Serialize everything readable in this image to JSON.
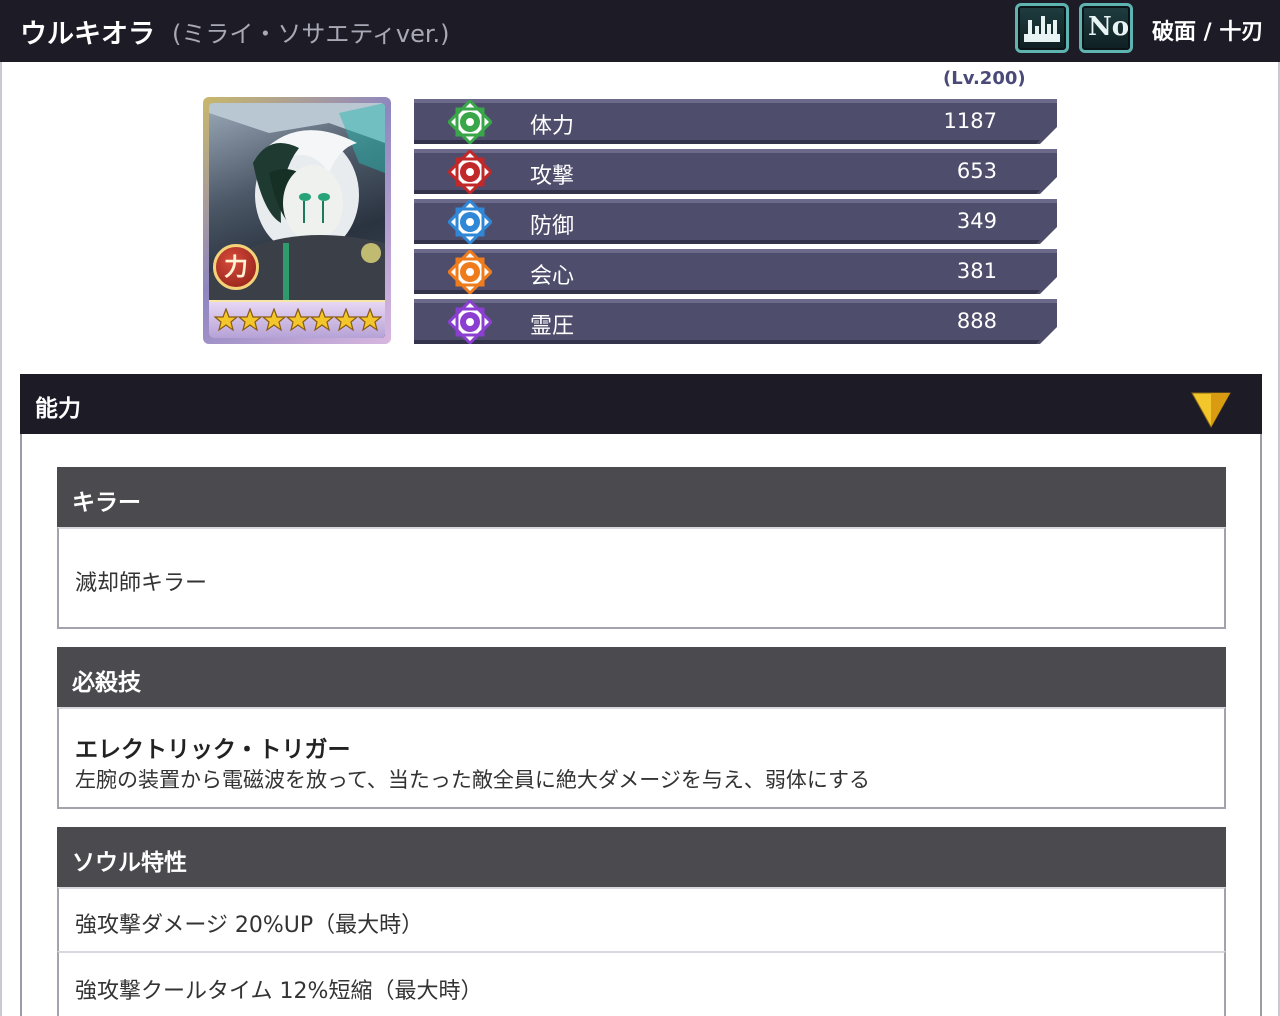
{
  "header": {
    "name": "ウルキオラ",
    "subtitle": "(ミライ・ソサエティver.)",
    "no_button": "No",
    "faction": "破面 / 十刃"
  },
  "card": {
    "attribute_glyph": "力",
    "stars": 7,
    "accent": "#f3c62c"
  },
  "stats": {
    "level": "(Lv.200)",
    "rows": [
      {
        "label": "体力",
        "value": "1187",
        "icon": "hp-icon",
        "color": "#3aa64a"
      },
      {
        "label": "攻撃",
        "value": "653",
        "icon": "attack-icon",
        "color": "#c0282a"
      },
      {
        "label": "防御",
        "value": "349",
        "icon": "defense-icon",
        "color": "#2f87d6"
      },
      {
        "label": "会心",
        "value": "381",
        "icon": "critical-icon",
        "color": "#ee7c1c"
      },
      {
        "label": "霊圧",
        "value": "888",
        "icon": "reiatsu-icon",
        "color": "#8b3fd0"
      }
    ]
  },
  "ability": {
    "title": "能力",
    "killer": {
      "heading": "キラー",
      "text": "滅却師キラー"
    },
    "special": {
      "heading": "必殺技",
      "name": "エレクトリック・トリガー",
      "desc": "左腕の装置から電磁波を放って、当たった敵全員に絶大ダメージを与え、弱体にする"
    },
    "soul": {
      "heading": "ソウル特性",
      "items": [
        "強攻撃ダメージ 20%UP（最大時）",
        "強攻撃クールタイム 12%短縮（最大時）"
      ]
    }
  }
}
